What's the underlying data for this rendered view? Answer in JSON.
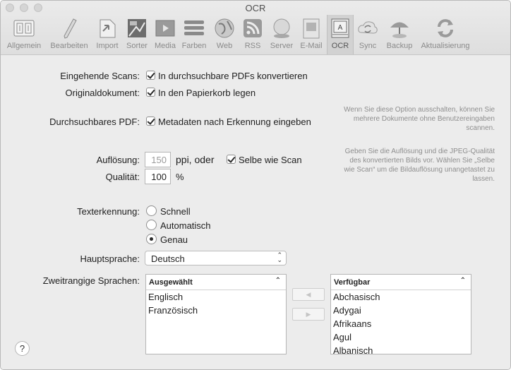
{
  "window": {
    "title": "OCR"
  },
  "toolbar": {
    "items": [
      {
        "label": "Allgemein",
        "icon": "general-icon"
      },
      {
        "label": "Bearbeiten",
        "icon": "pencil-icon"
      },
      {
        "label": "Import",
        "icon": "import-icon"
      },
      {
        "label": "Sorter",
        "icon": "sorter-icon"
      },
      {
        "label": "Media",
        "icon": "media-icon"
      },
      {
        "label": "Farben",
        "icon": "colors-icon"
      },
      {
        "label": "Web",
        "icon": "globe-icon"
      },
      {
        "label": "RSS",
        "icon": "rss-icon"
      },
      {
        "label": "Server",
        "icon": "server-icon"
      },
      {
        "label": "E-Mail",
        "icon": "email-icon"
      },
      {
        "label": "OCR",
        "icon": "ocr-icon",
        "active": true
      },
      {
        "label": "Sync",
        "icon": "sync-icon"
      },
      {
        "label": "Backup",
        "icon": "backup-icon"
      },
      {
        "label": "Aktualisierung",
        "icon": "update-icon"
      }
    ]
  },
  "incoming": {
    "label": "Eingehende Scans:",
    "option": "In durchsuchbare PDFs konvertieren",
    "checked": true
  },
  "original": {
    "label": "Originaldokument:",
    "option": "In den Papierkorb legen",
    "checked": true
  },
  "searchable": {
    "label": "Durchsuchbares PDF:",
    "option": "Metadaten nach Erkennung eingeben",
    "checked": true,
    "hint": [
      "Wenn Sie diese Option ausschalten, können Sie",
      "mehrere Dokumente ohne Benutzereingaben",
      "scannen."
    ]
  },
  "resolution": {
    "label": "Auflösung:",
    "value": "150",
    "unit": "ppi, oder",
    "same_option": "Selbe wie Scan",
    "same_checked": true,
    "hint": [
      "Geben Sie die Auflösung und die JPEG-Qualität",
      "des konvertierten Bilds vor. Wählen Sie „Selbe",
      "wie Scan“ um die Bildauflösung unangetastet zu",
      "lassen."
    ]
  },
  "quality": {
    "label": "Qualität:",
    "value": "100",
    "unit": "%"
  },
  "recognition": {
    "label": "Texterkennung:",
    "options": [
      "Schnell",
      "Automatisch",
      "Genau"
    ],
    "selected": "Genau"
  },
  "primary_language": {
    "label": "Hauptsprache:",
    "value": "Deutsch"
  },
  "secondary_languages": {
    "label": "Zweitrangige Sprachen:",
    "selected_header": "Ausgewählt",
    "selected": [
      "Englisch",
      "Französisch"
    ],
    "available_header": "Verfügbar",
    "available": [
      "Abchasisch",
      "Adygai",
      "Afrikaans",
      "Agul",
      "Albanisch"
    ],
    "move_left": "◀",
    "move_right": "▶"
  },
  "help": {
    "label": "?"
  }
}
